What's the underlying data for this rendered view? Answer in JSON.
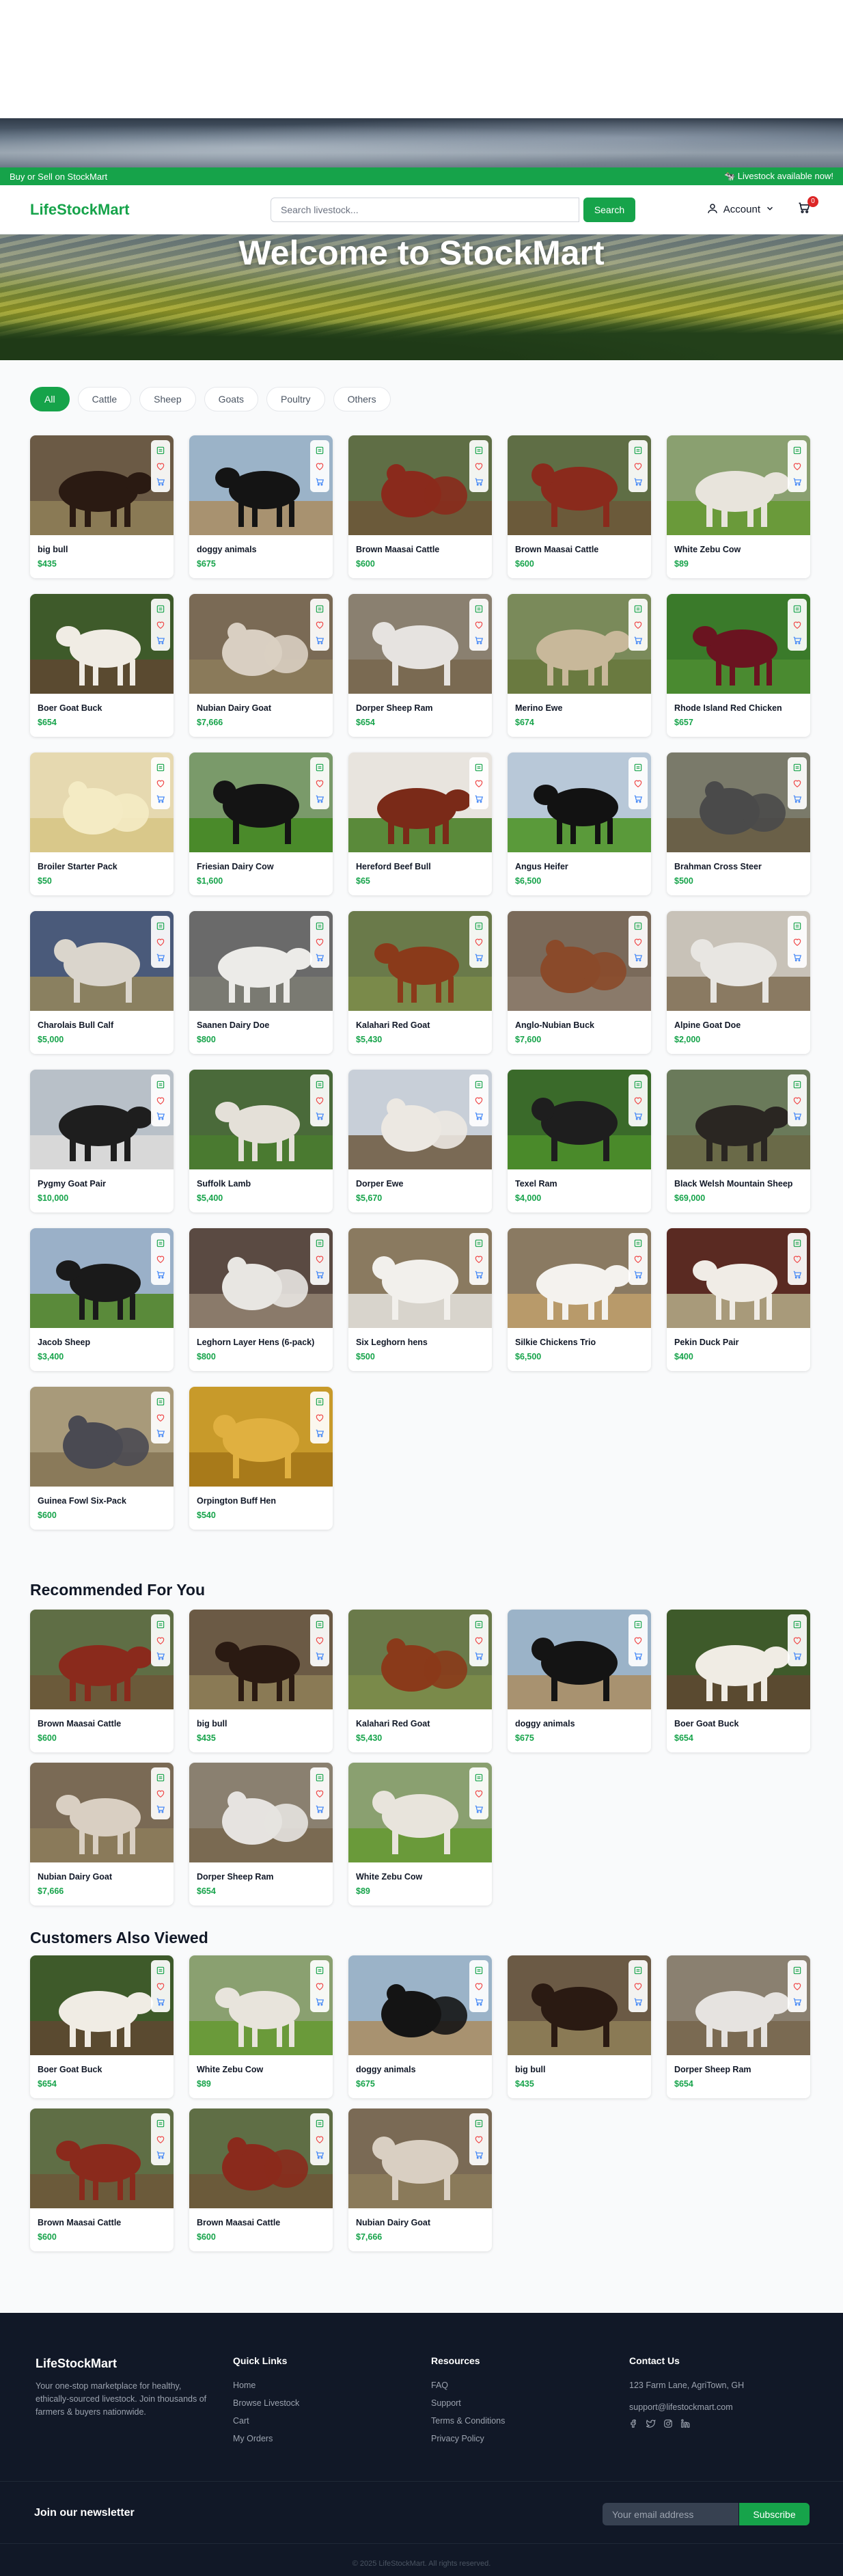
{
  "announcement": {
    "left": "Buy or Sell on StockMart",
    "right": "🐄 Livestock available now!"
  },
  "header": {
    "logo": "LifeStockMart",
    "search_placeholder": "Search livestock...",
    "search_button": "Search",
    "account_label": "Account",
    "cart_count": "0"
  },
  "hero": {
    "title": "Welcome to StockMart"
  },
  "filters": [
    "All",
    "Cattle",
    "Sheep",
    "Goats",
    "Poultry",
    "Others"
  ],
  "active_filter": "All",
  "products": [
    {
      "name": "big bull",
      "price": "$435",
      "bg": "#6b5a45",
      "fg": "#2a1a12",
      "ground": "#8a7a55"
    },
    {
      "name": "doggy animals",
      "price": "$675",
      "bg": "#9bb3c8",
      "fg": "#141414",
      "ground": "#a89270"
    },
    {
      "name": "Brown Maasai Cattle",
      "price": "$600",
      "bg": "#5f6e45",
      "fg": "#8a2a1c",
      "ground": "#6b5a3a"
    },
    {
      "name": "Brown Maasai Cattle",
      "price": "$600",
      "bg": "#5f6e45",
      "fg": "#8a2a1c",
      "ground": "#6b5a3a"
    },
    {
      "name": "White Zebu Cow",
      "price": "$89",
      "bg": "#8aa070",
      "fg": "#e8e4dc",
      "ground": "#6a9a3a"
    },
    {
      "name": "Boer Goat Buck",
      "price": "$654",
      "bg": "#3e5a2a",
      "fg": "#f0ece4",
      "ground": "#5a4a30"
    },
    {
      "name": "Nubian Dairy Goat",
      "price": "$7,666",
      "bg": "#7a6a55",
      "fg": "#d9cfc2",
      "ground": "#8a7a5a"
    },
    {
      "name": "Dorper Sheep Ram",
      "price": "$654",
      "bg": "#8a8070",
      "fg": "#e6e3e0",
      "ground": "#7a6a52"
    },
    {
      "name": "Merino Ewe",
      "price": "$674",
      "bg": "#7a8a5a",
      "fg": "#c8b89a",
      "ground": "#6a7a40"
    },
    {
      "name": "Rhode Island Red Chicken",
      "price": "$657",
      "bg": "#3a7a2a",
      "fg": "#6a1420",
      "ground": "#4a8a30"
    },
    {
      "name": "Broiler Starter Pack",
      "price": "$50",
      "bg": "#e6d9b0",
      "fg": "#f4ebc4",
      "ground": "#d9c88a"
    },
    {
      "name": "Friesian Dairy Cow",
      "price": "$1,600",
      "bg": "#7a9a6a",
      "fg": "#141414",
      "ground": "#4a8a2a"
    },
    {
      "name": "Hereford Beef Bull",
      "price": "$65",
      "bg": "#e8e4de",
      "fg": "#7a2a18",
      "ground": "#5a8a3a"
    },
    {
      "name": "Angus Heifer",
      "price": "$6,500",
      "bg": "#b8c8d8",
      "fg": "#121212",
      "ground": "#5a9a3a"
    },
    {
      "name": "Brahman Cross Steer",
      "price": "$500",
      "bg": "#7a7a6a",
      "fg": "#4a4a4a",
      "ground": "#6a6048"
    },
    {
      "name": "Charolais Bull Calf",
      "price": "$5,000",
      "bg": "#4a5a7a",
      "fg": "#dad5cc",
      "ground": "#8a8060"
    },
    {
      "name": "Saanen Dairy Doe",
      "price": "$800",
      "bg": "#6a6a6a",
      "fg": "#ecebe8",
      "ground": "#7a7a72"
    },
    {
      "name": "Kalahari Red Goat",
      "price": "$5,430",
      "bg": "#6a7a4a",
      "fg": "#8a3a1a",
      "ground": "#7a8a4a"
    },
    {
      "name": "Anglo-Nubian Buck",
      "price": "$7,600",
      "bg": "#7a6a5a",
      "fg": "#8a4a2a",
      "ground": "#8a7a6a"
    },
    {
      "name": "Alpine Goat Doe",
      "price": "$2,000",
      "bg": "#c8c2b8",
      "fg": "#e8e6e2",
      "ground": "#8a7a62"
    },
    {
      "name": "Pygmy Goat Pair",
      "price": "$10,000",
      "bg": "#b8c0c8",
      "fg": "#1e1e1e",
      "ground": "#d8d8d8"
    },
    {
      "name": "Suffolk Lamb",
      "price": "$5,400",
      "bg": "#4a6a3a",
      "fg": "#e4e0d8",
      "ground": "#4a7a30"
    },
    {
      "name": "Dorper Ewe",
      "price": "$5,670",
      "bg": "#c8cfd8",
      "fg": "#ece8e2",
      "ground": "#7a6a55"
    },
    {
      "name": "Texel Ram",
      "price": "$4,000",
      "bg": "#3a6a2a",
      "fg": "#1e1e1e",
      "ground": "#4a8a2a"
    },
    {
      "name": "Black Welsh Mountain Sheep",
      "price": "$69,000",
      "bg": "#6a7a5a",
      "fg": "#2a2622",
      "ground": "#6a6a48"
    },
    {
      "name": "Jacob Sheep",
      "price": "$3,400",
      "bg": "#9ab0c8",
      "fg": "#1a1a1a",
      "ground": "#5a8a3a"
    },
    {
      "name": "Leghorn Layer Hens (6-pack)",
      "price": "$800",
      "bg": "#5a4a42",
      "fg": "#e8e6e2",
      "ground": "#8a7a6a"
    },
    {
      "name": "Six Leghorn hens",
      "price": "$500",
      "bg": "#8a7a60",
      "fg": "#f2f0ec",
      "ground": "#d8d4cc"
    },
    {
      "name": "Silkie Chickens Trio",
      "price": "$6,500",
      "bg": "#8a7a62",
      "fg": "#f4f2ee",
      "ground": "#b89a6a"
    },
    {
      "name": "Pekin Duck Pair",
      "price": "$400",
      "bg": "#5a2a22",
      "fg": "#f0ece6",
      "ground": "#a89a7a"
    },
    {
      "name": "Guinea Fowl Six-Pack",
      "price": "$600",
      "bg": "#a89a7a",
      "fg": "#4a4a52",
      "ground": "#8a7a5a"
    },
    {
      "name": "Orpington Buff Hen",
      "price": "$540",
      "bg": "#c89a2a",
      "fg": "#e0b040",
      "ground": "#a87a1a"
    }
  ],
  "recommended": {
    "title": "Recommended For You",
    "items": [
      {
        "name": "Brown Maasai Cattle",
        "price": "$600",
        "bg": "#5f6e45",
        "fg": "#8a2a1c",
        "ground": "#6b5a3a"
      },
      {
        "name": "big bull",
        "price": "$435",
        "bg": "#6b5a45",
        "fg": "#2a1a12",
        "ground": "#8a7a55"
      },
      {
        "name": "Kalahari Red Goat",
        "price": "$5,430",
        "bg": "#6a7a4a",
        "fg": "#8a3a1a",
        "ground": "#7a8a4a"
      },
      {
        "name": "doggy animals",
        "price": "$675",
        "bg": "#9bb3c8",
        "fg": "#141414",
        "ground": "#a89270"
      },
      {
        "name": "Boer Goat Buck",
        "price": "$654",
        "bg": "#3e5a2a",
        "fg": "#f0ece4",
        "ground": "#5a4a30"
      },
      {
        "name": "Nubian Dairy Goat",
        "price": "$7,666",
        "bg": "#7a6a55",
        "fg": "#d9cfc2",
        "ground": "#8a7a5a"
      },
      {
        "name": "Dorper Sheep Ram",
        "price": "$654",
        "bg": "#8a8070",
        "fg": "#e6e3e0",
        "ground": "#7a6a52"
      },
      {
        "name": "White Zebu Cow",
        "price": "$89",
        "bg": "#8aa070",
        "fg": "#e8e4dc",
        "ground": "#6a9a3a"
      }
    ]
  },
  "also_viewed": {
    "title": "Customers Also Viewed",
    "items": [
      {
        "name": "Boer Goat Buck",
        "price": "$654",
        "bg": "#3e5a2a",
        "fg": "#f0ece4",
        "ground": "#5a4a30"
      },
      {
        "name": "White Zebu Cow",
        "price": "$89",
        "bg": "#8aa070",
        "fg": "#e8e4dc",
        "ground": "#6a9a3a"
      },
      {
        "name": "doggy animals",
        "price": "$675",
        "bg": "#9bb3c8",
        "fg": "#141414",
        "ground": "#a89270"
      },
      {
        "name": "big bull",
        "price": "$435",
        "bg": "#6b5a45",
        "fg": "#2a1a12",
        "ground": "#8a7a55"
      },
      {
        "name": "Dorper Sheep Ram",
        "price": "$654",
        "bg": "#8a8070",
        "fg": "#e6e3e0",
        "ground": "#7a6a52"
      },
      {
        "name": "Brown Maasai Cattle",
        "price": "$600",
        "bg": "#5f6e45",
        "fg": "#8a2a1c",
        "ground": "#6b5a3a"
      },
      {
        "name": "Brown Maasai Cattle",
        "price": "$600",
        "bg": "#5f6e45",
        "fg": "#8a2a1c",
        "ground": "#6b5a3a"
      },
      {
        "name": "Nubian Dairy Goat",
        "price": "$7,666",
        "bg": "#7a6a55",
        "fg": "#d9cfc2",
        "ground": "#8a7a5a"
      }
    ]
  },
  "footer": {
    "brand": "LifeStockMart",
    "description": "Your one-stop marketplace for healthy, ethically-sourced livestock. Join thousands of farmers & buyers nationwide.",
    "quick_links": {
      "title": "Quick Links",
      "items": [
        "Home",
        "Browse Livestock",
        "Cart",
        "My Orders"
      ]
    },
    "resources": {
      "title": "Resources",
      "items": [
        "FAQ",
        "Support",
        "Terms & Conditions",
        "Privacy Policy"
      ]
    },
    "contact": {
      "title": "Contact Us",
      "address": "123 Farm Lane, AgriTown, GH",
      "email": "support@lifestockmart.com"
    },
    "newsletter_title": "Join our newsletter",
    "newsletter_placeholder": "Your email address",
    "newsletter_button": "Subscribe",
    "copyright": "© 2025 LifeStockMart. All rights reserved."
  },
  "colors": {
    "accent": "#16a34a",
    "footer_bg": "#111827",
    "badge": "#dc2626"
  }
}
